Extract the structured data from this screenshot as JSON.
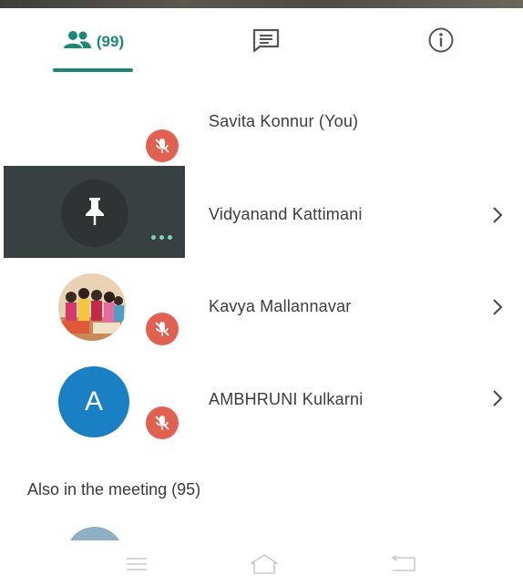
{
  "tabs": {
    "people_count": "(99)",
    "accent": "#1e8676",
    "icons": [
      "people-icon",
      "chat-icon",
      "info-icon"
    ]
  },
  "participants": [
    {
      "name": "Savita Konnur (You)",
      "muted": true,
      "avatar": "none"
    },
    {
      "name": "Vidyanand Kattimani",
      "muted": false,
      "avatar": "video-tile-pin"
    },
    {
      "name": "Kavya Mallannavar",
      "muted": true,
      "avatar": "group-photo"
    },
    {
      "name": "AMBHRUNI Kulkarni",
      "muted": true,
      "avatar": "letter",
      "initial": "A",
      "avatar_color": "#1a80c4"
    }
  ],
  "also_in_meeting": "Also in the meeting (95)",
  "colors": {
    "mute_badge": "#e0614f",
    "text": "#3c3c3c"
  }
}
